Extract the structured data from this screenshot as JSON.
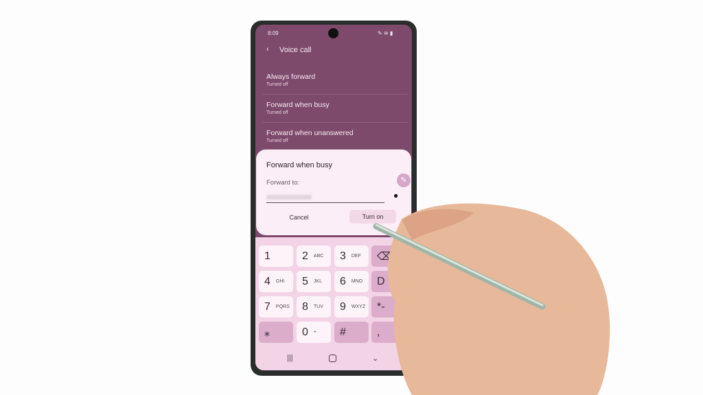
{
  "status": {
    "time": "8:09"
  },
  "header": {
    "title": "Voice call",
    "back_icon": "chevron-left-icon"
  },
  "list": [
    {
      "title": "Always forward",
      "status": "Turned off"
    },
    {
      "title": "Forward when busy",
      "status": "Turned off"
    },
    {
      "title": "Forward when unanswered",
      "status": "Turned off"
    }
  ],
  "dialog": {
    "title": "Forward when busy",
    "field_label": "Forward to:",
    "field_value": "",
    "contact_icon": "person-icon",
    "cancel": "Cancel",
    "confirm": "Turn on"
  },
  "keypad": {
    "keys": [
      {
        "n": "1",
        "l": ""
      },
      {
        "n": "2",
        "l": "ABC"
      },
      {
        "n": "3",
        "l": "DEF"
      },
      {
        "n": "⌫",
        "l": ""
      },
      {
        "n": "4",
        "l": "GHI"
      },
      {
        "n": "5",
        "l": "JKL"
      },
      {
        "n": "6",
        "l": "MNO"
      },
      {
        "n": "D",
        "l": ""
      },
      {
        "n": "7",
        "l": "PQRS"
      },
      {
        "n": "8",
        "l": "TUV"
      },
      {
        "n": "9",
        "l": "WXYZ"
      },
      {
        "n": "*-",
        "l": ""
      },
      {
        "n": "⁎",
        "l": ""
      },
      {
        "n": "0",
        "l": "+"
      },
      {
        "n": "#",
        "l": ""
      },
      {
        "n": ",",
        "l": ""
      }
    ]
  },
  "colors": {
    "screen_bg": "#7d4a6c",
    "dialog_bg": "#fbeef6",
    "keypad_bg": "#f2d4e6"
  }
}
